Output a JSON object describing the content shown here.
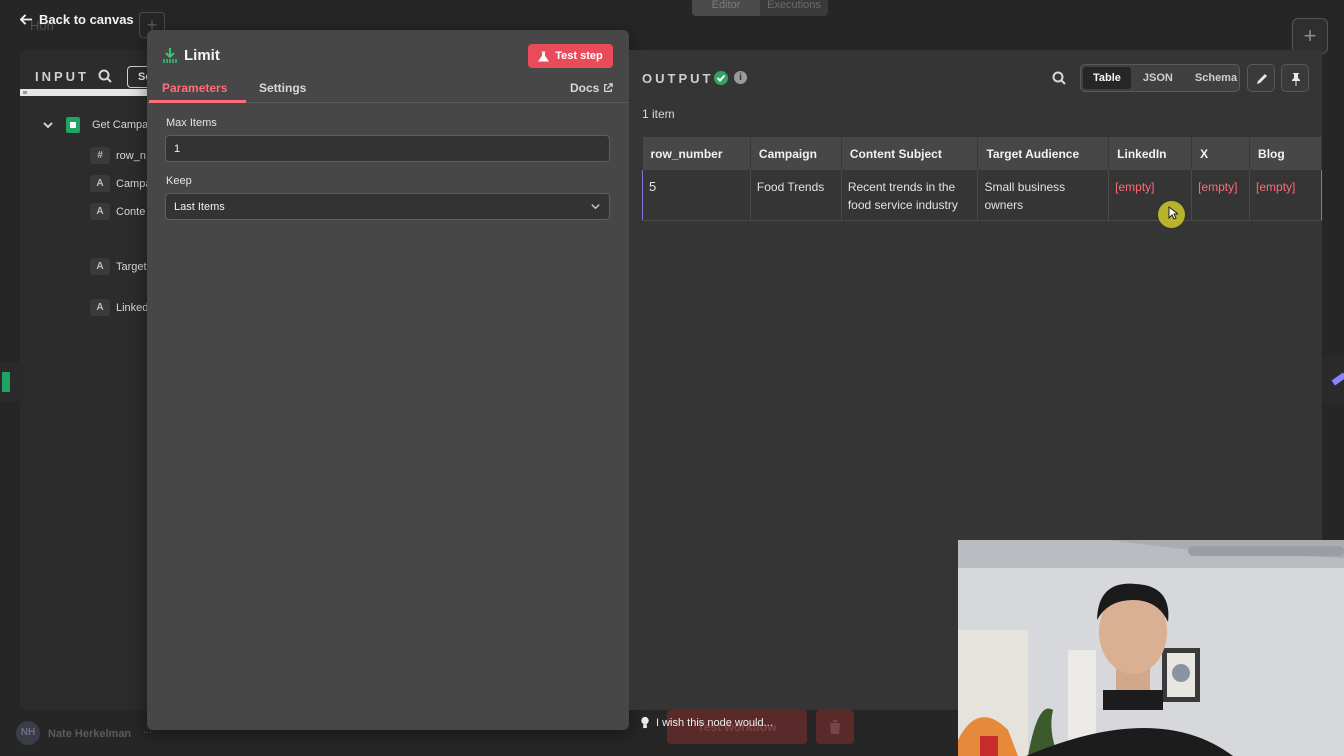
{
  "canvas": {
    "back_label": "Back to canvas",
    "workflow_ghost": "Hon",
    "top_tabs": [
      "Editor",
      "Executions"
    ],
    "add_plus": "+",
    "user_initials": "NH",
    "user_name": "Nate Herkelman",
    "user_more": "...",
    "test_workflow_ghost": "Test workflow",
    "wish_text": "I wish this node would..."
  },
  "input": {
    "title": "INPUT",
    "tab_fragment": "Sc",
    "tree_root": "Get Campa",
    "fields": [
      {
        "type": "#",
        "name": "row_n"
      },
      {
        "type": "A",
        "name": "Campa"
      },
      {
        "type": "A",
        "name": "Conte"
      },
      {
        "type": "A",
        "name": "Target"
      },
      {
        "type": "A",
        "name": "Linked"
      }
    ]
  },
  "node": {
    "title": "Limit",
    "test_step_label": "Test step",
    "tabs": [
      "Parameters",
      "Settings"
    ],
    "active_tab": "Parameters",
    "docs_label": "Docs",
    "max_items_label": "Max Items",
    "max_items_value": "1",
    "keep_label": "Keep",
    "keep_value": "Last Items"
  },
  "output": {
    "title": "OUTPUT",
    "info": "i",
    "views": [
      "Table",
      "JSON",
      "Schema"
    ],
    "active_view": "Table",
    "item_count": "1 item",
    "columns": [
      "row_number",
      "Campaign",
      "Content Subject",
      "Target Audience",
      "LinkedIn",
      "X",
      "Blog"
    ],
    "rows": [
      [
        "5",
        "Food Trends",
        "Recent trends in the food service industry",
        "Small business owners",
        "[empty]",
        "[empty]",
        "[empty]"
      ]
    ]
  },
  "colors": {
    "accent": "#ff6d7a",
    "test_button": "#ea4b5b",
    "success": "#2ea662",
    "empty_value": "#ff6b78"
  }
}
